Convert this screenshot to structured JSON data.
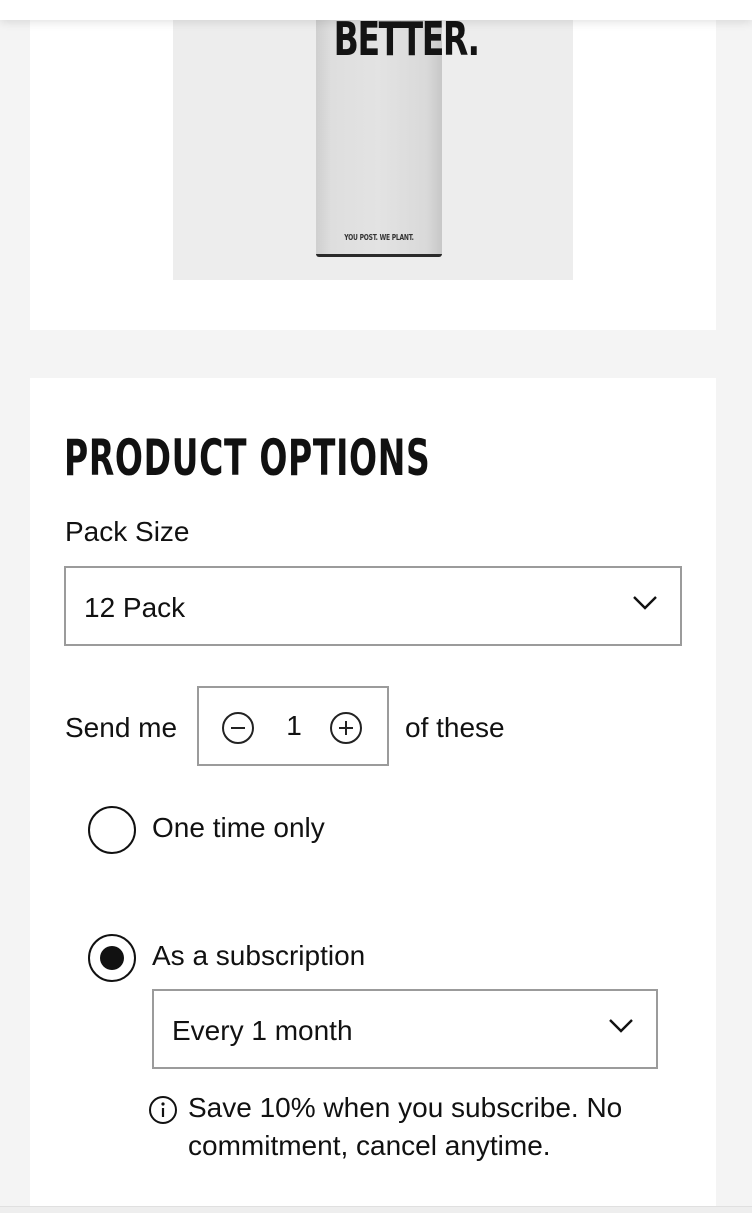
{
  "product_image": {
    "carton_headline": "BETTER.",
    "carton_tagline": "YOU POST. WE PLANT."
  },
  "product_options": {
    "title": "PRODUCT OPTIONS",
    "pack_size_label": "Pack Size",
    "pack_size_value": "12 Pack",
    "send_me_label": "Send me",
    "quantity": "1",
    "of_these_label": "of these",
    "purchase_options": [
      {
        "label": "One time only",
        "selected": false
      },
      {
        "label": "As a subscription",
        "selected": true
      }
    ],
    "frequency_value": "Every 1 month",
    "savings_note": "Save 10% when you subscribe. No commitment, cancel anytime."
  },
  "icons": {
    "chevron": "chevron-down-icon",
    "minus": "minus-circle-icon",
    "plus": "plus-circle-icon",
    "info": "info-circle-icon"
  }
}
